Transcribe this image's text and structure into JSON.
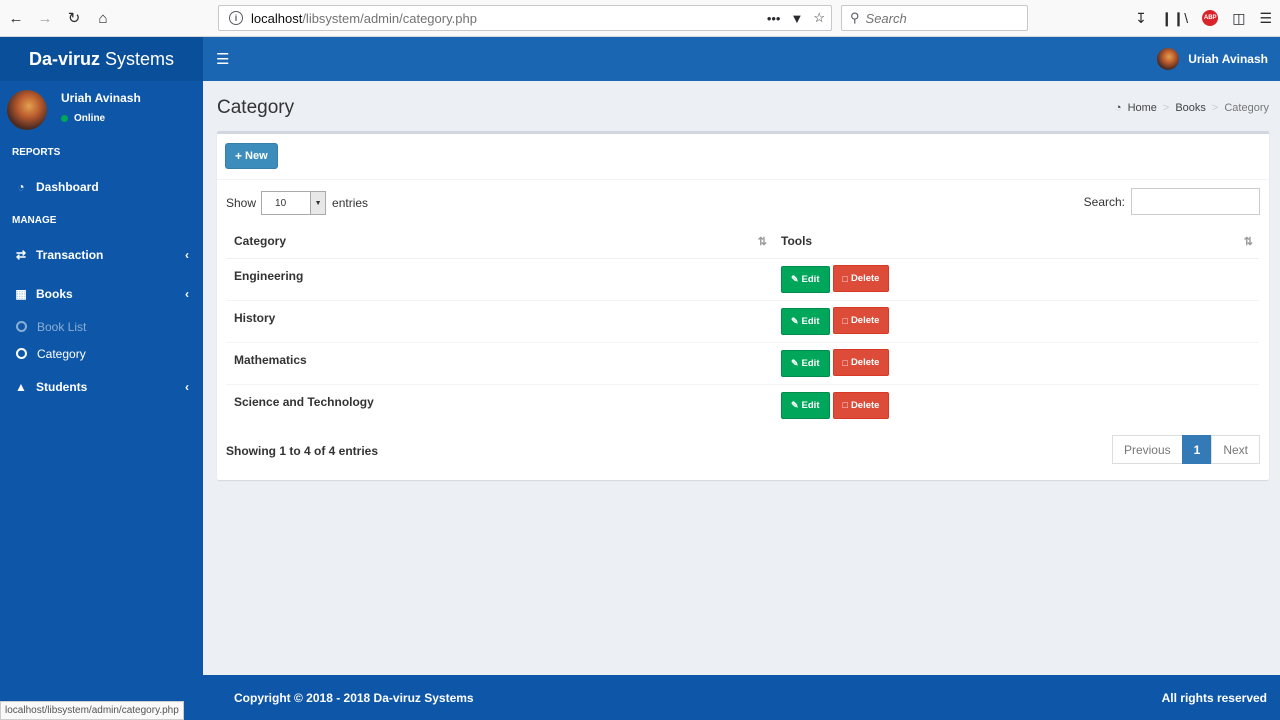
{
  "browser": {
    "url_host": "localhost",
    "url_path": "/libsystem/admin/category.php",
    "search_placeholder": "Search",
    "status_url": "localhost/libsystem/admin/category.php"
  },
  "app": {
    "logo_bold": "Da-viruz",
    "logo_rest": "Systems",
    "user_name": "Uriah Avinash",
    "user_status": "Online"
  },
  "sidebar": {
    "reports_header": "REPORTS",
    "dashboard": "Dashboard",
    "manage_header": "MANAGE",
    "transaction": "Transaction",
    "books": "Books",
    "book_list": "Book List",
    "category": "Category",
    "students": "Students"
  },
  "page": {
    "title": "Category",
    "breadcrumb": [
      "Home",
      "Books",
      "Category"
    ],
    "new_label": "New",
    "show_label": "Show",
    "entries_value": "10",
    "entries_label": "entries",
    "search_label": "Search:",
    "columns": [
      "Category",
      "Tools"
    ],
    "rows": [
      "Engineering",
      "History",
      "Mathematics",
      "Science and Technology"
    ],
    "edit_label": "Edit",
    "delete_label": "Delete",
    "info": "Showing 1 to 4 of 4 entries",
    "pagination": [
      "Previous",
      "1",
      "Next"
    ]
  },
  "footer": {
    "copyright": "Copyright © 2018 - 2018 Da-viruz Systems",
    "rights": "All rights reserved"
  },
  "colors": {
    "sidebar": "#0e57a8",
    "topnav": "#1a66b3",
    "edit": "#00a65a",
    "delete": "#dd4b39",
    "primary": "#3c8dbc"
  }
}
